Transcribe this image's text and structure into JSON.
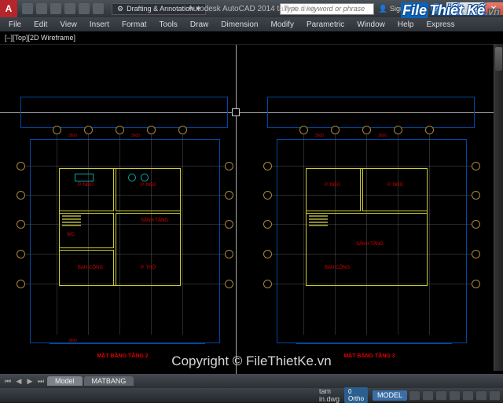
{
  "titlebar": {
    "app_initial": "A",
    "workspace": "Drafting & Annotation",
    "title": "Autodesk AutoCAD 2014   tam in.dwg",
    "search_placeholder": "Type a keyword or phrase",
    "signin": "Sign In",
    "win_min": "—",
    "win_max": "❐",
    "win_close": "✕"
  },
  "menubar": {
    "items": [
      "File",
      "Edit",
      "View",
      "Insert",
      "Format",
      "Tools",
      "Draw",
      "Dimension",
      "Modify",
      "Parametric",
      "Window",
      "Help",
      "Express"
    ]
  },
  "viewport_label": "[–][Top][2D Wireframe]",
  "plans": {
    "left_title": "MẶT BẰNG TẦNG 2",
    "right_title": "MẶT BẰNG TẦNG 3",
    "rooms": [
      "BAN CÔNG",
      "P. NGỦ",
      "P. NGỦ",
      "WC",
      "WC",
      "SẢNH TẦNG",
      "P. THỜ"
    ]
  },
  "layout_tabs": {
    "tab1": "Model",
    "tab2": "MATBANG"
  },
  "statusbar": {
    "filename": "tam in.dwg",
    "ortho": "0 Ortho",
    "model": "MODEL"
  },
  "watermark": "Copyright © FileThietKe.vn",
  "logo": {
    "a": "File",
    "b": "Thiết Kế",
    "c": ".vn"
  }
}
